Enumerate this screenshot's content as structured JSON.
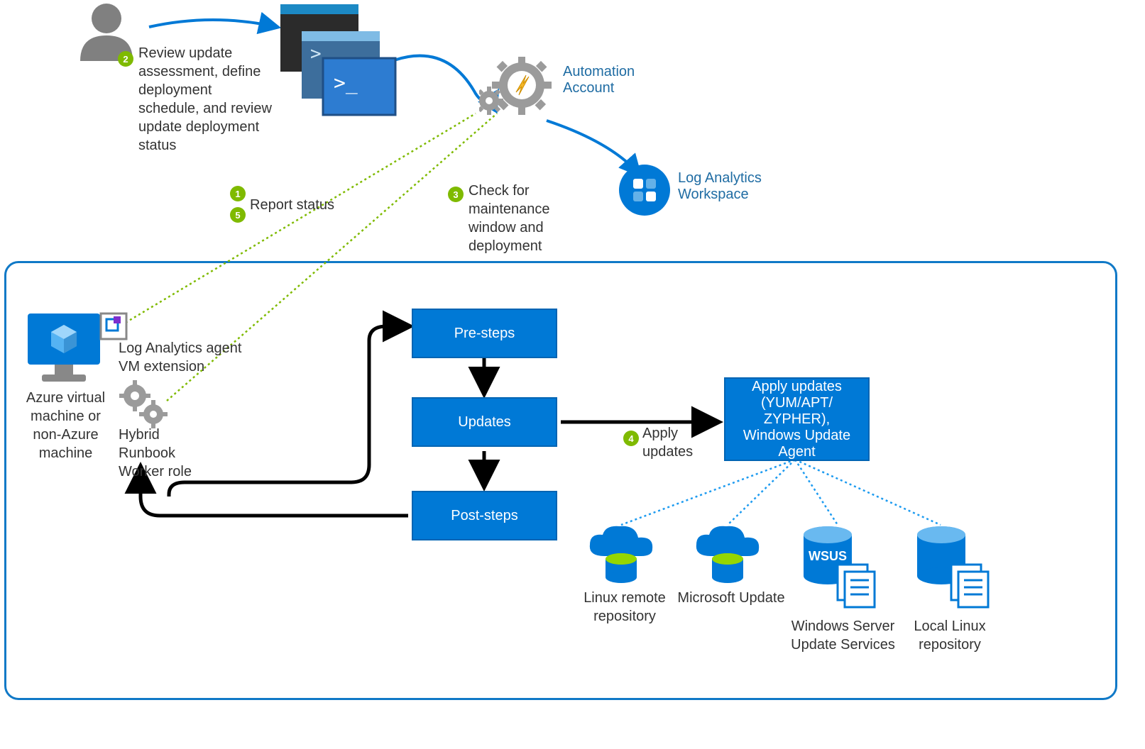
{
  "badges": {
    "b1": "1",
    "b2": "2",
    "b3": "3",
    "b4": "4",
    "b5": "5"
  },
  "steps": {
    "review": "Review update assessment, define deployment schedule, and review update deployment status",
    "reportStatus": "Report status",
    "checkMaint": "Check for maintenance window and deployment",
    "applyUpdates": "Apply updates"
  },
  "labels": {
    "automationAccount": "Automation Account",
    "logAnalyticsWorkspace": "Log Analytics Workspace",
    "azureVm": "Azure virtual machine or non-Azure machine",
    "laAgent": "Log Analytics agent VM extension",
    "hybridWorker": "Hybrid Runbook Worker role",
    "linuxRemote": "Linux remote repository",
    "msUpdate": "Microsoft Update",
    "wsus": "Windows Server Update Services",
    "wsusBadge": "WSUS",
    "localLinux": "Local Linux repository"
  },
  "boxes": {
    "preSteps": "Pre-steps",
    "updates": "Updates",
    "postSteps": "Post-steps",
    "applyUpdatesBox": "Apply updates (YUM/APT/ ZYPHER), Windows Update Agent"
  },
  "colors": {
    "blue": "#0079d6",
    "darkBlue": "#005ba1",
    "green": "#7fba00",
    "gray": "#888888",
    "black": "#000000",
    "yellow": "#f4b728"
  }
}
